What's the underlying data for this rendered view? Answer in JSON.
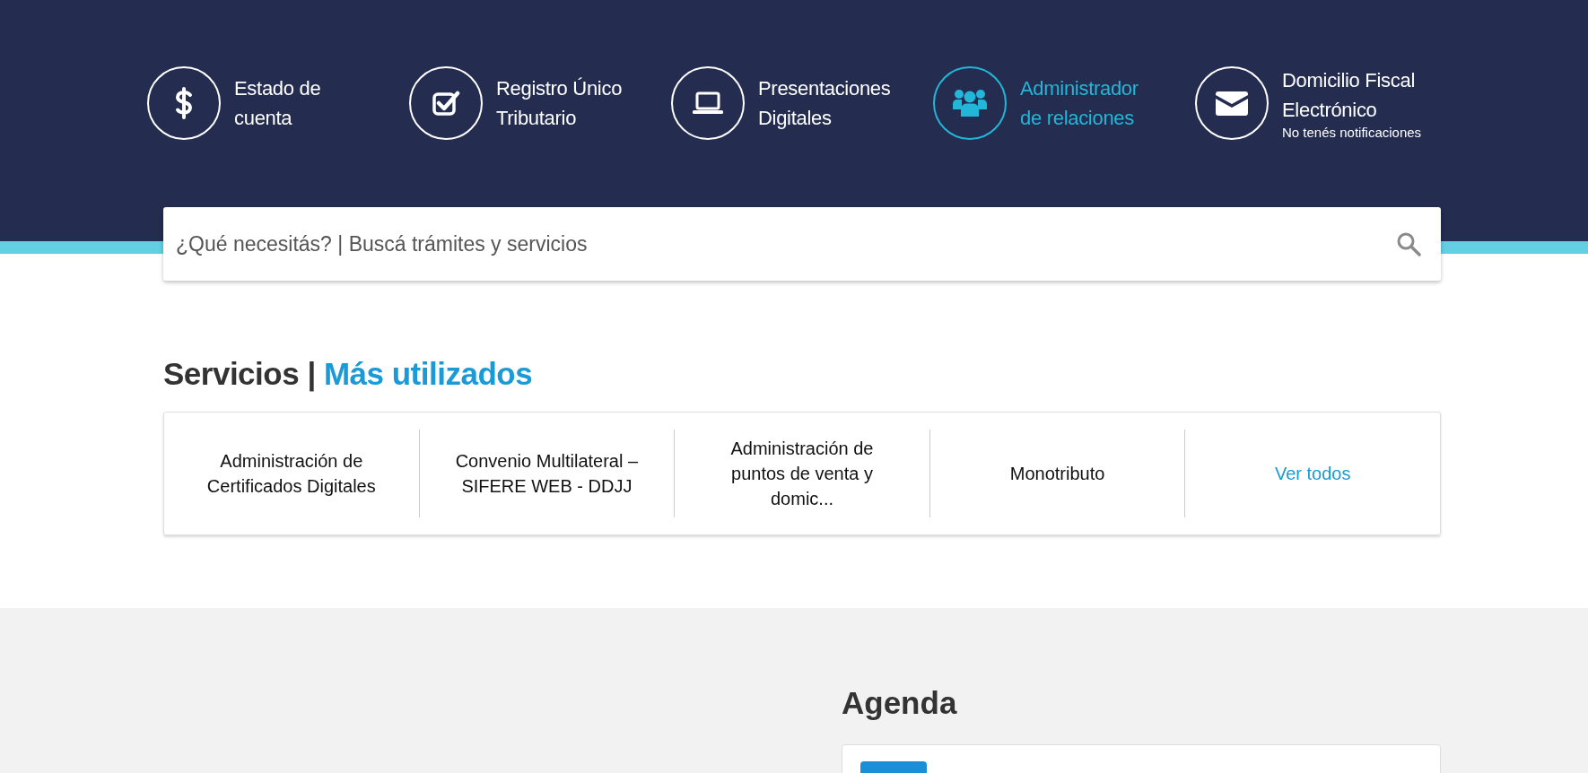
{
  "nav": [
    {
      "kind": "dollar",
      "lines": [
        "Estado de",
        "cuenta"
      ],
      "selected": false
    },
    {
      "kind": "check",
      "lines": [
        "Registro Único",
        "Tributario"
      ],
      "selected": false
    },
    {
      "kind": "laptop",
      "lines": [
        "Presentaciones",
        "Digitales"
      ],
      "selected": false
    },
    {
      "kind": "people",
      "lines": [
        "Administrador",
        "de relaciones"
      ],
      "selected": true
    },
    {
      "kind": "mail",
      "lines": [
        "Domicilio Fiscal",
        "Electrónico"
      ],
      "note": "No tenés notificaciones",
      "selected": false
    }
  ],
  "search": {
    "placeholder": "¿Qué necesitás? | Buscá trámites y servicios"
  },
  "services": {
    "title": "Servicios |",
    "subtitle": "Más utilizados",
    "items": [
      {
        "kind": "service",
        "label": "Administración de Certificados Digitales"
      },
      {
        "kind": "service",
        "label": "Convenio Multilateral – SIFERE WEB - DDJJ"
      },
      {
        "kind": "service",
        "label": "Administración de puntos de venta y domic..."
      },
      {
        "kind": "service",
        "label": "Monotributo"
      },
      {
        "kind": "link",
        "label": "Ver todos"
      }
    ]
  },
  "agenda": {
    "title": "Agenda"
  }
}
